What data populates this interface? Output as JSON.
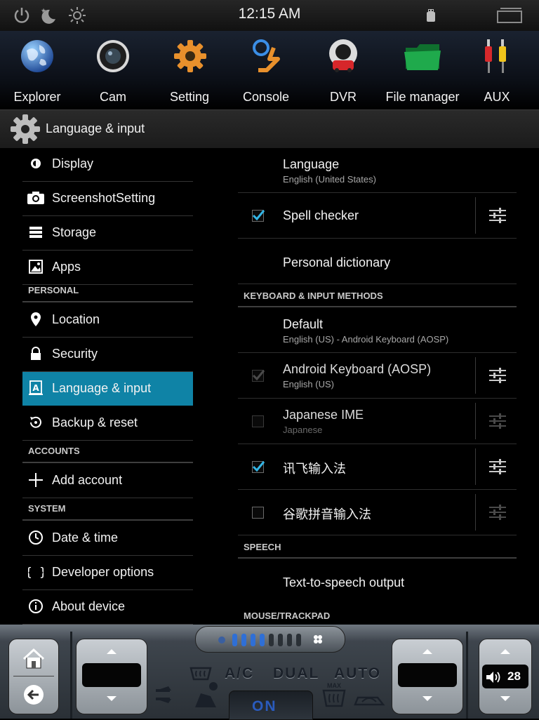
{
  "status_bar": {
    "time": "12:15 AM",
    "icons": [
      "power-icon",
      "night-mode-icon",
      "brightness-icon",
      "usb-icon",
      "recent-apps-icon"
    ]
  },
  "dock": {
    "apps": [
      {
        "label": "Explorer",
        "icon": "globe-icon"
      },
      {
        "label": "Cam",
        "icon": "camera-lens-icon"
      },
      {
        "label": "Setting",
        "icon": "gear-icon"
      },
      {
        "label": "Console",
        "icon": "car-seat-steering-icon"
      },
      {
        "label": "DVR",
        "icon": "dashcam-icon"
      },
      {
        "label": "File manager",
        "icon": "folder-icon"
      },
      {
        "label": "AUX",
        "icon": "rca-cable-icon"
      }
    ]
  },
  "header": {
    "title": "Language & input",
    "icon": "settings-gear-icon"
  },
  "left_nav": {
    "items": [
      {
        "label": "Display",
        "icon": "brightness-icon"
      },
      {
        "label": "ScreenshotSetting",
        "icon": "camera-icon"
      },
      {
        "label": "Storage",
        "icon": "storage-icon"
      },
      {
        "label": "Apps",
        "icon": "apps-icon"
      },
      {
        "label": "Location",
        "icon": "location-pin-icon"
      },
      {
        "label": "Security",
        "icon": "lock-icon"
      },
      {
        "label": "Language & input",
        "icon": "keyboard-a-icon"
      },
      {
        "label": "Backup & reset",
        "icon": "backup-icon"
      },
      {
        "label": "Add account",
        "icon": "plus-icon"
      },
      {
        "label": "Date & time",
        "icon": "clock-icon"
      },
      {
        "label": "Developer options",
        "icon": "braces-icon"
      },
      {
        "label": "About device",
        "icon": "info-icon"
      }
    ],
    "headings": {
      "personal": "PERSONAL",
      "accounts": "ACCOUNTS",
      "system": "SYSTEM"
    },
    "selected": "Language & input",
    "accent": "#0f83a6"
  },
  "right_pane": {
    "language": {
      "title": "Language",
      "summary": "English (United States)"
    },
    "spell_checker": {
      "title": "Spell checker",
      "checked": true
    },
    "personal_dictionary": {
      "title": "Personal dictionary"
    },
    "keyboard_heading": "KEYBOARD & INPUT METHODS",
    "default": {
      "title": "Default",
      "summary": "English (US) - Android Keyboard (AOSP)"
    },
    "android_keyboard": {
      "title": "Android Keyboard (AOSP)",
      "summary": "English (US)",
      "checked": true,
      "enabled": false
    },
    "japanese_ime": {
      "title": "Japanese IME",
      "summary": "Japanese",
      "checked": false,
      "enabled": false
    },
    "xunfei": {
      "title": "讯飞输入法",
      "checked": true
    },
    "google_pinyin": {
      "title": "谷歌拼音输入法",
      "checked": false
    },
    "speech_heading": "SPEECH",
    "tts": {
      "title": "Text-to-speech output"
    },
    "mouse_heading": "MOUSE/TRACKPAD",
    "checkbox_color": "#33b5e5"
  },
  "climate": {
    "ac": "A/C",
    "dual": "DUAL",
    "auto": "AUTO",
    "on": "ON",
    "max": "MAX",
    "volume": "28",
    "fan_level": 0.5
  }
}
